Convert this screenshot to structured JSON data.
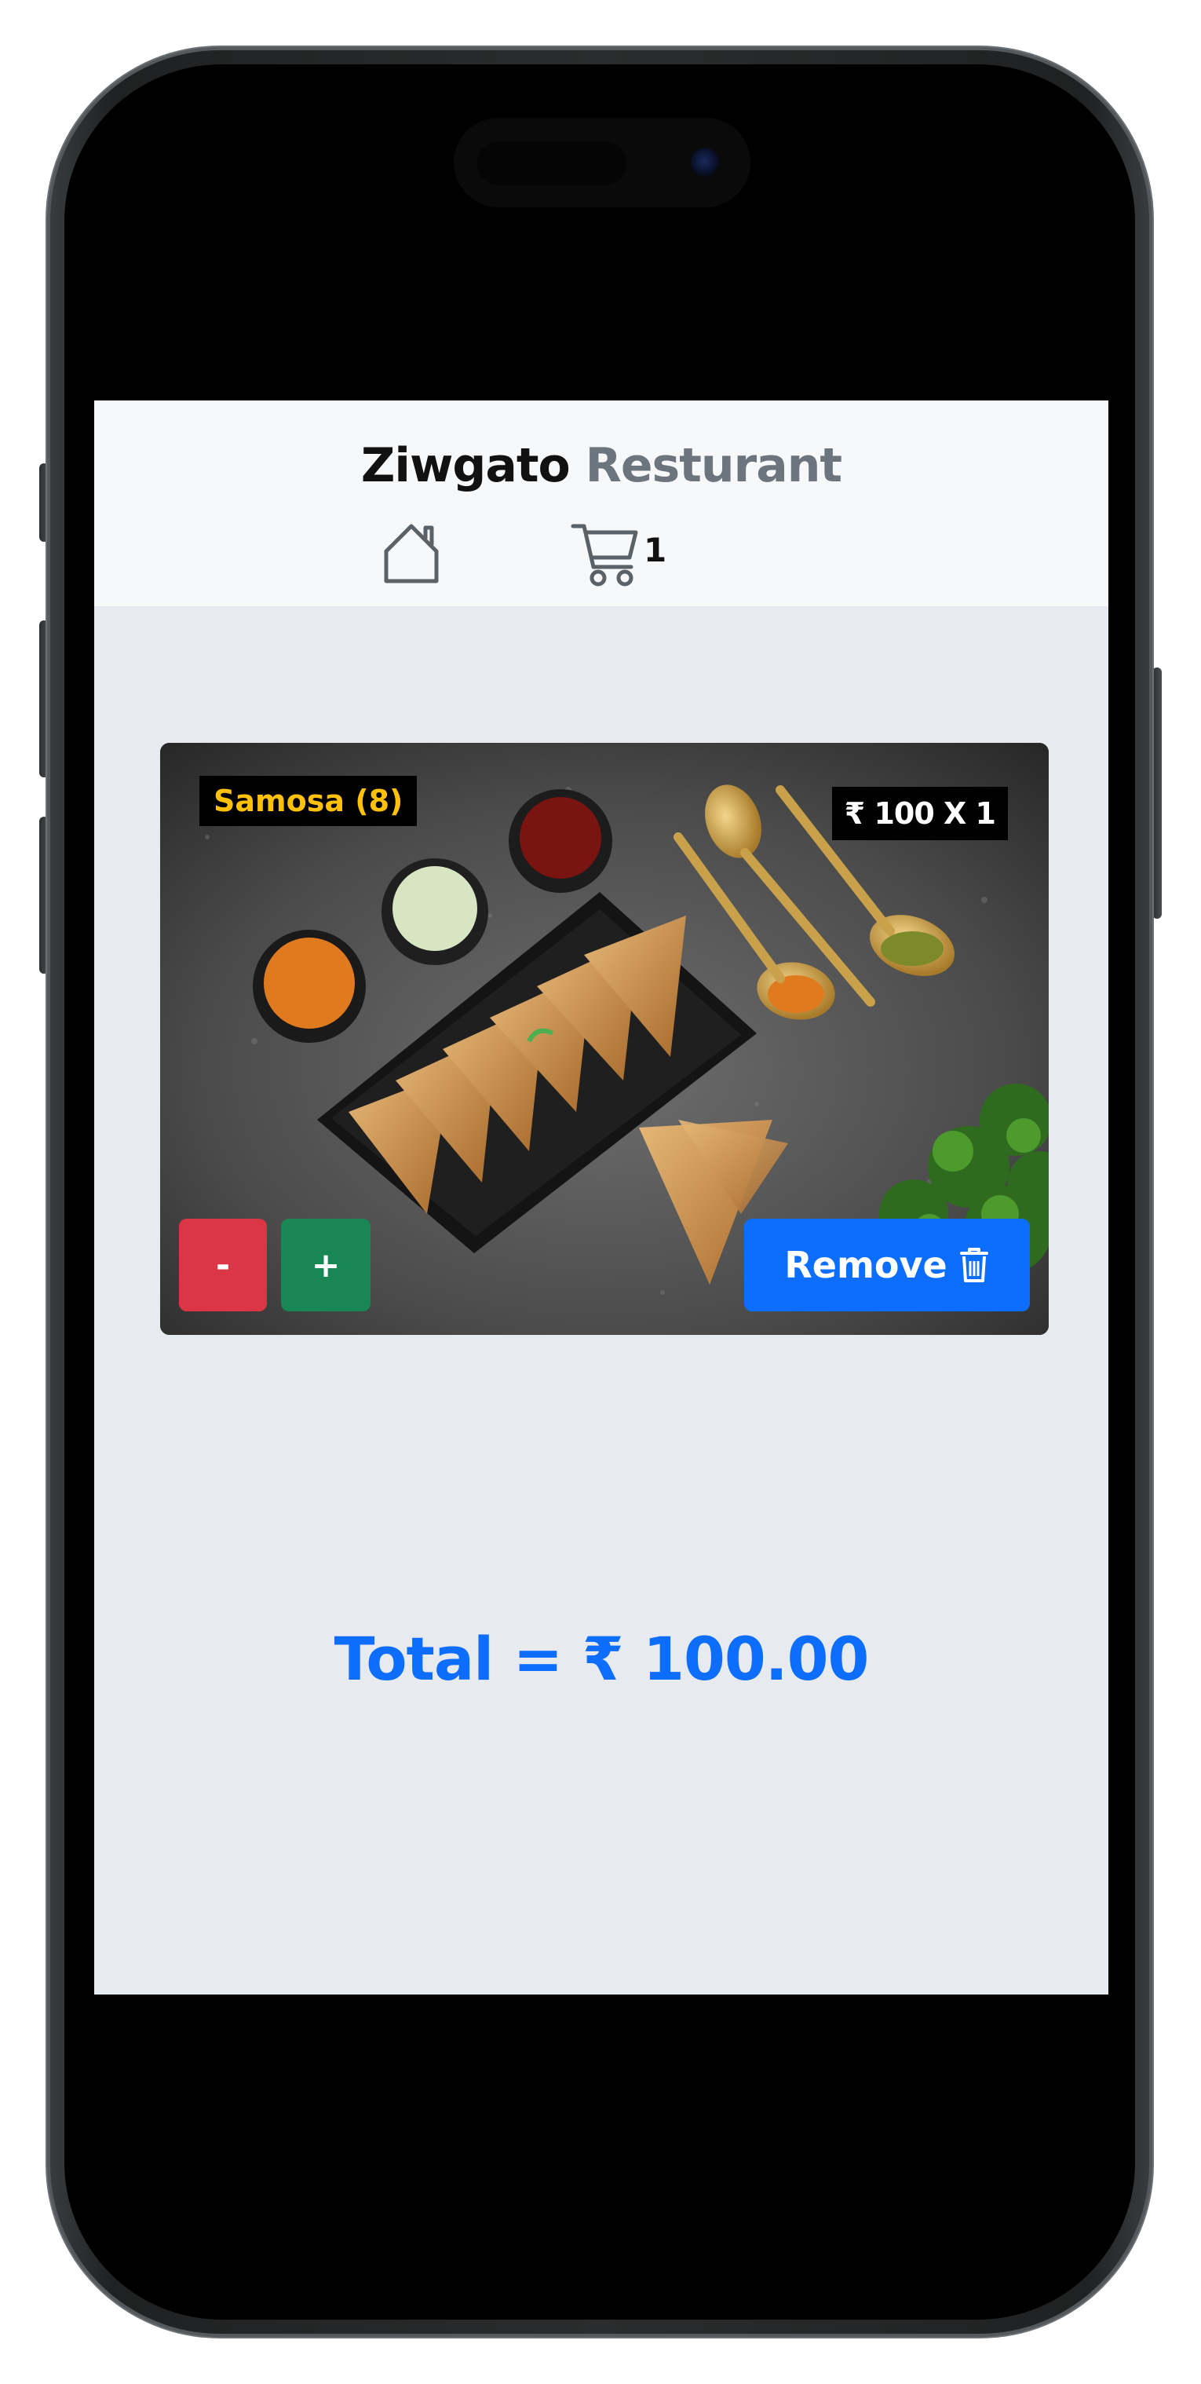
{
  "app": {
    "brand_primary": "Ziwgato",
    "brand_secondary": "Resturant"
  },
  "nav": {
    "home_icon": "home-icon",
    "cart_icon": "cart-icon",
    "cart_count": "1"
  },
  "cart": {
    "items": [
      {
        "name": "Samosa (8)",
        "price_label": "₹ 100 X 1",
        "minus_label": "-",
        "plus_label": "+",
        "remove_label": "Remove",
        "remove_icon": "trash-icon",
        "image": "samosa-platter-photo"
      }
    ],
    "total_label": "Total = ₹ 100.00"
  },
  "colors": {
    "brand_dark": "#111111",
    "brand_muted": "#6c757d",
    "danger": "#dc3545",
    "success": "#198754",
    "primary": "#0d6efd",
    "warning": "#ffc107",
    "page_bg": "#e7eaee",
    "nav_bg": "#f7f8fa"
  }
}
